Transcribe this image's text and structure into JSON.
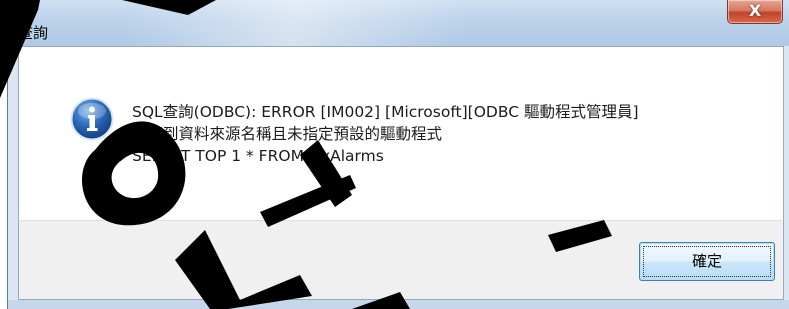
{
  "window": {
    "title": "查詢",
    "close_glyph": "X"
  },
  "message": {
    "icon": "info-icon",
    "lines": [
      "SQL查詢(ODBC): ERROR [IM002] [Microsoft][ODBC 驅動程式管理員]",
      "找不到資料來源名稱且未指定預設的驅動程式",
      "SELECT TOP 1 * FROM FixAlarms"
    ]
  },
  "buttons": {
    "ok_label": "確定"
  },
  "colors": {
    "titlebar": "#bcd2ea",
    "close_button": "#c2432a",
    "info_icon": "#1f5ca8",
    "button_border": "#3c7fb1",
    "watermark": "#000000"
  }
}
